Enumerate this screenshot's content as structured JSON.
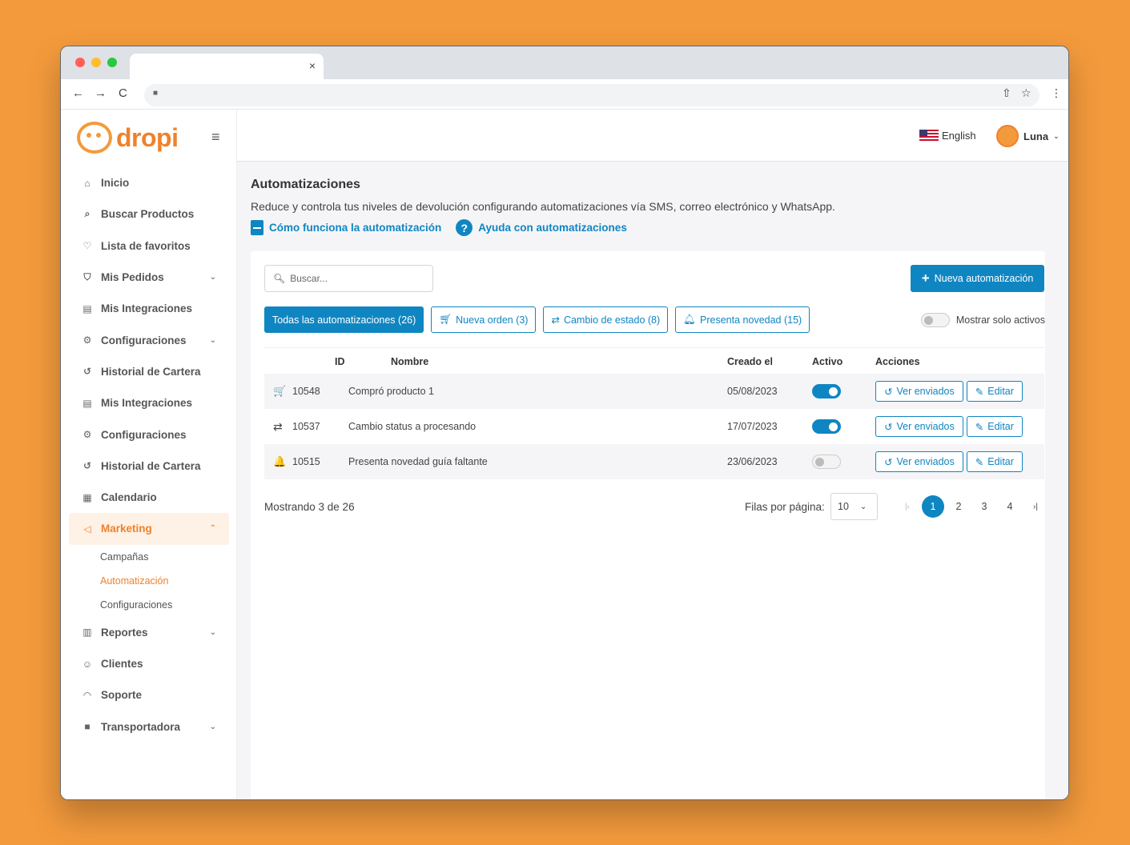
{
  "browser": {
    "tab_close": "×",
    "back": "←",
    "forward": "→",
    "reload": "C",
    "share": "⇧",
    "star": "☆",
    "menu": "⋮"
  },
  "sidebar": {
    "logo_text": "dropi",
    "items": [
      {
        "label": "Inicio",
        "icon": "home-icon",
        "glyph": "⌂"
      },
      {
        "label": "Buscar Productos",
        "icon": "search-icon",
        "glyph": "⌕"
      },
      {
        "label": "Lista de favoritos",
        "icon": "heart-icon",
        "glyph": "♡"
      },
      {
        "label": "Mis Pedidos",
        "icon": "cart-icon",
        "glyph": "⛉"
      },
      {
        "label": "Mis Integraciones",
        "icon": "store-icon",
        "glyph": "▤"
      },
      {
        "label": "Configuraciones",
        "icon": "gear-icon",
        "glyph": "⚙"
      },
      {
        "label": "Historial de Cartera",
        "icon": "history-icon",
        "glyph": "↺"
      },
      {
        "label": "Mis Integraciones",
        "icon": "store-icon",
        "glyph": "▤"
      },
      {
        "label": "Configuraciones",
        "icon": "gear-icon",
        "glyph": "⚙"
      },
      {
        "label": "Historial de Cartera",
        "icon": "history-icon",
        "glyph": "↺"
      },
      {
        "label": "Calendario",
        "icon": "calendar-icon",
        "glyph": "▦"
      },
      {
        "label": "Marketing",
        "icon": "megaphone-icon",
        "glyph": "📢"
      },
      {
        "label": "Reportes",
        "icon": "bar-chart-icon",
        "glyph": "▥"
      },
      {
        "label": "Clientes",
        "icon": "users-icon",
        "glyph": "☺"
      },
      {
        "label": "Soporte",
        "icon": "headset-icon",
        "glyph": "◠"
      },
      {
        "label": "Transportadora",
        "icon": "truck-icon",
        "glyph": "■"
      }
    ],
    "marketing_sub": [
      "Campañas",
      "Automatización",
      "Configuraciones"
    ]
  },
  "topbar": {
    "language": "English",
    "user_name": "Luna"
  },
  "page": {
    "title": "Automatizaciones",
    "description": "Reduce y controla tus niveles de devolución configurando automatizaciones vía SMS, correo electrónico y WhatsApp.",
    "link_how": "Cómo funciona la automatización",
    "link_help": "Ayuda con automatizaciones",
    "search_placeholder": "Buscar...",
    "new_button": "Nueva automatización",
    "filters": {
      "all": "Todas las automatizaciones (26)",
      "new_order": "Nueva orden (3)",
      "status_change": "Cambio de estado (8)",
      "novelty": "Presenta novedad (15)"
    },
    "only_active": "Mostrar solo activos",
    "columns": {
      "id": "ID",
      "name": "Nombre",
      "created": "Creado el",
      "active": "Activo",
      "actions": "Acciones"
    },
    "rows": [
      {
        "icon": "cart-icon",
        "glyph": "🛒",
        "id": "10548",
        "name": "Compró producto 1",
        "created": "05/08/2023",
        "active": true
      },
      {
        "icon": "swap-icon",
        "glyph": "⇄",
        "id": "10537",
        "name": "Cambio status a procesando",
        "created": "17/07/2023",
        "active": true
      },
      {
        "icon": "bell-icon",
        "glyph": "🔔",
        "id": "10515",
        "name": "Presenta novedad guía faltante",
        "created": "23/06/2023",
        "active": false
      }
    ],
    "action_view": "Ver enviados",
    "action_edit": "Editar",
    "showing": "Mostrando 3 de 26",
    "rows_per_page_label": "Filas por página:",
    "rows_per_page": "10",
    "pages": [
      "1",
      "2",
      "3",
      "4"
    ],
    "current_page": "1"
  },
  "colors": {
    "accent": "#0f86c2",
    "brand": "#f0812a",
    "background": "#f39a3c"
  }
}
